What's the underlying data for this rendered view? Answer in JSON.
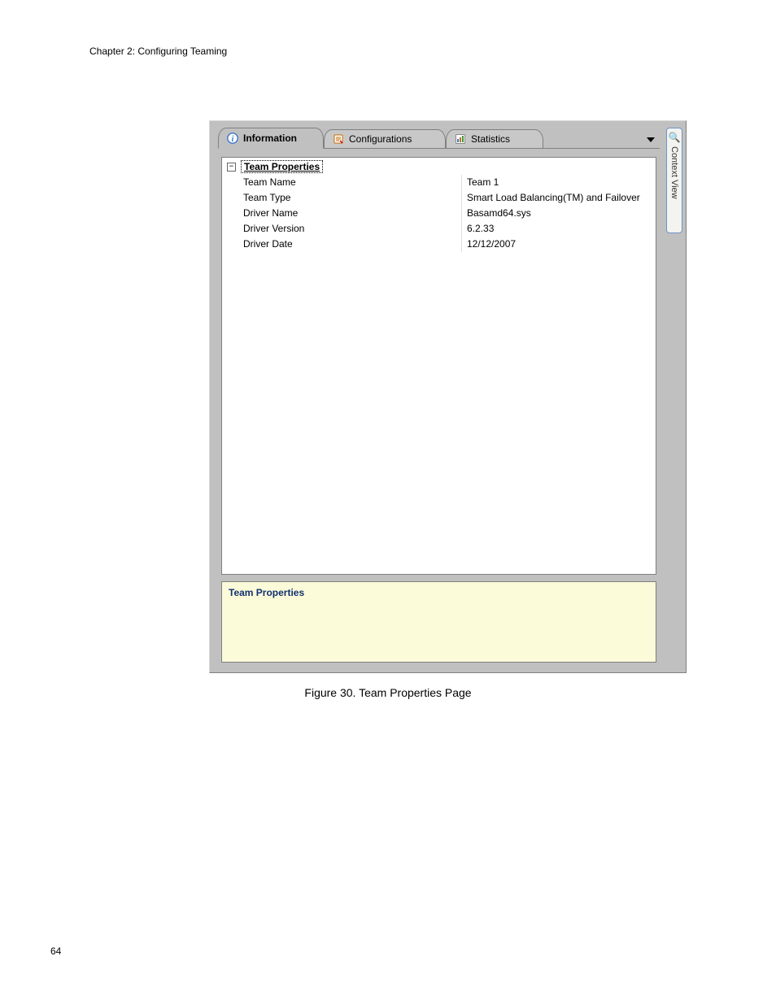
{
  "page_header": "Chapter 2: Configuring Teaming",
  "page_number": "64",
  "figure_caption": "Figure 30. Team Properties Page",
  "side_tab": {
    "label": "Context View",
    "icon": "magnifier-icon"
  },
  "tabs": [
    {
      "label": "Information",
      "icon": "info-icon",
      "active": true
    },
    {
      "label": "Configurations",
      "icon": "config-icon",
      "active": false
    },
    {
      "label": "Statistics",
      "icon": "stats-icon",
      "active": false
    }
  ],
  "property_group": {
    "title": "Team Properties",
    "rows": [
      {
        "label": "Team Name",
        "value": "Team 1"
      },
      {
        "label": "Team Type",
        "value": "Smart Load Balancing(TM) and Failover"
      },
      {
        "label": "Driver Name",
        "value": "Basamd64.sys"
      },
      {
        "label": "Driver Version",
        "value": "6.2.33"
      },
      {
        "label": "Driver Date",
        "value": "12/12/2007"
      }
    ]
  },
  "details_panel": {
    "title": "Team Properties"
  }
}
